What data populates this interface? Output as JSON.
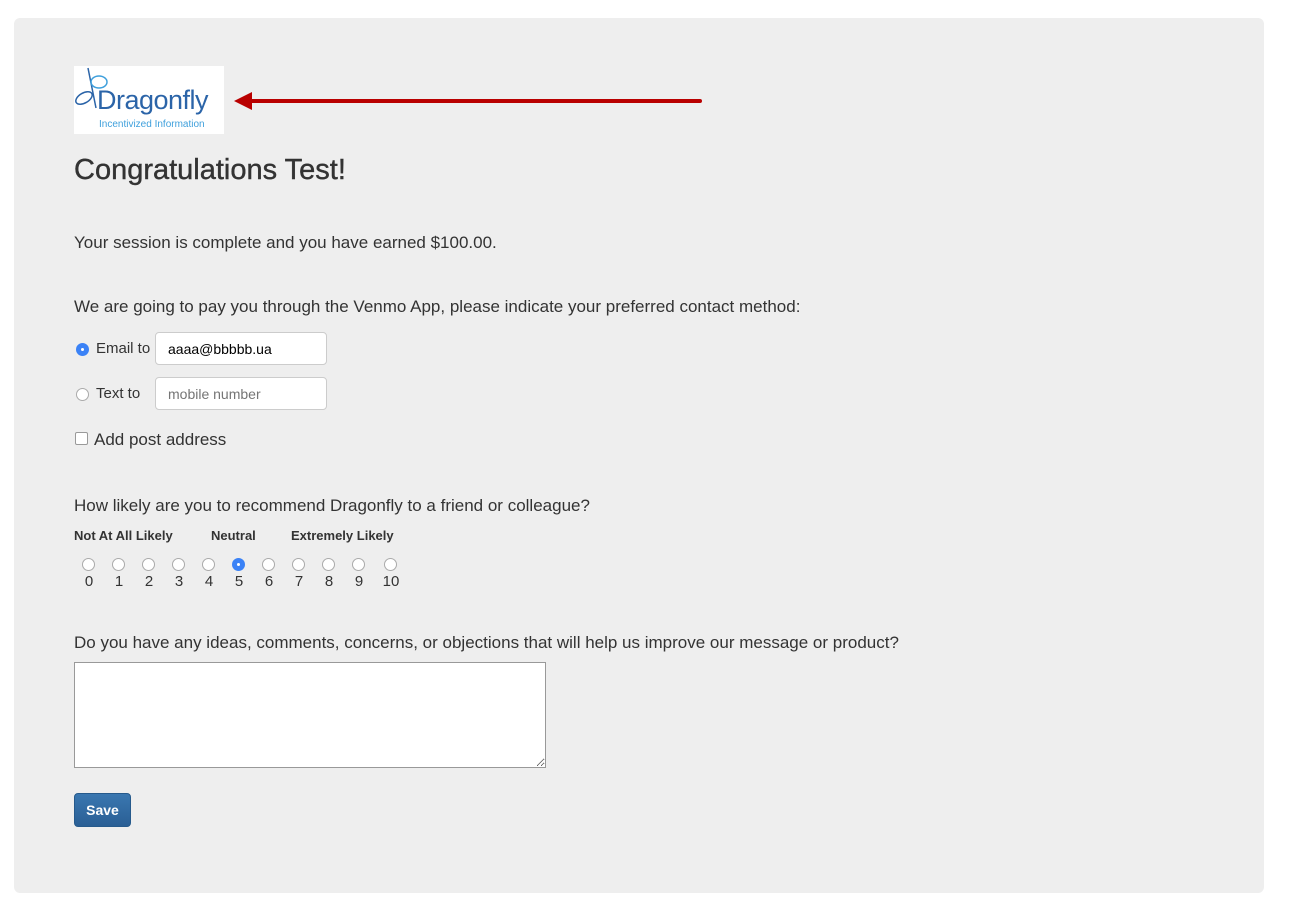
{
  "logo": {
    "name": "Dragonfly",
    "tagline": "Incentivized Information"
  },
  "title": "Congratulations Test!",
  "earned_text": "Your session is complete and you have earned $100.00.",
  "contact": {
    "prompt": "We are going to pay you through the Venmo App, please indicate your preferred contact method:",
    "email_label": "Email to",
    "email_value": "aaaa@bbbbb.ua",
    "email_selected": true,
    "text_label": "Text to",
    "text_placeholder": "mobile number",
    "text_selected": false,
    "post_label": "Add post address",
    "post_checked": false
  },
  "nps": {
    "question": "How likely are you to recommend Dragonfly to a friend or colleague?",
    "low_label": "Not At All Likely",
    "mid_label": "Neutral",
    "high_label": "Extremely Likely",
    "options": [
      "0",
      "1",
      "2",
      "3",
      "4",
      "5",
      "6",
      "7",
      "8",
      "9",
      "10"
    ],
    "selected": 5
  },
  "feedback": {
    "question": "Do you have any ideas, comments, concerns, or objections that will help us improve our message or product?",
    "value": ""
  },
  "save_label": "Save",
  "colors": {
    "accent": "#3b82f6",
    "button": "#2f6aa3",
    "arrow": "#b90000"
  }
}
